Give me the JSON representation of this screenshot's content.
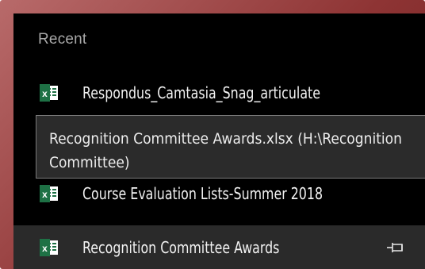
{
  "section": {
    "title": "Recent"
  },
  "recent": {
    "items": [
      {
        "label": "Respondus_Camtasia_Snag_articulate",
        "icon": "excel-file-icon"
      },
      {
        "label": "Course Evaluation Lists-Summer 2018",
        "icon": "excel-file-icon"
      },
      {
        "label": "Recognition Committee Awards",
        "icon": "excel-file-icon",
        "pinned_action": "pin-icon"
      }
    ]
  },
  "tooltip": {
    "line1": "Recognition Committee Awards.xlsx (H:\\Recognition",
    "line2": "Committee)"
  },
  "colors": {
    "frame": "#8e3434",
    "panel_background": "#000000",
    "selected_row": "#2a2a2a",
    "excel_green": "#1e7145"
  }
}
